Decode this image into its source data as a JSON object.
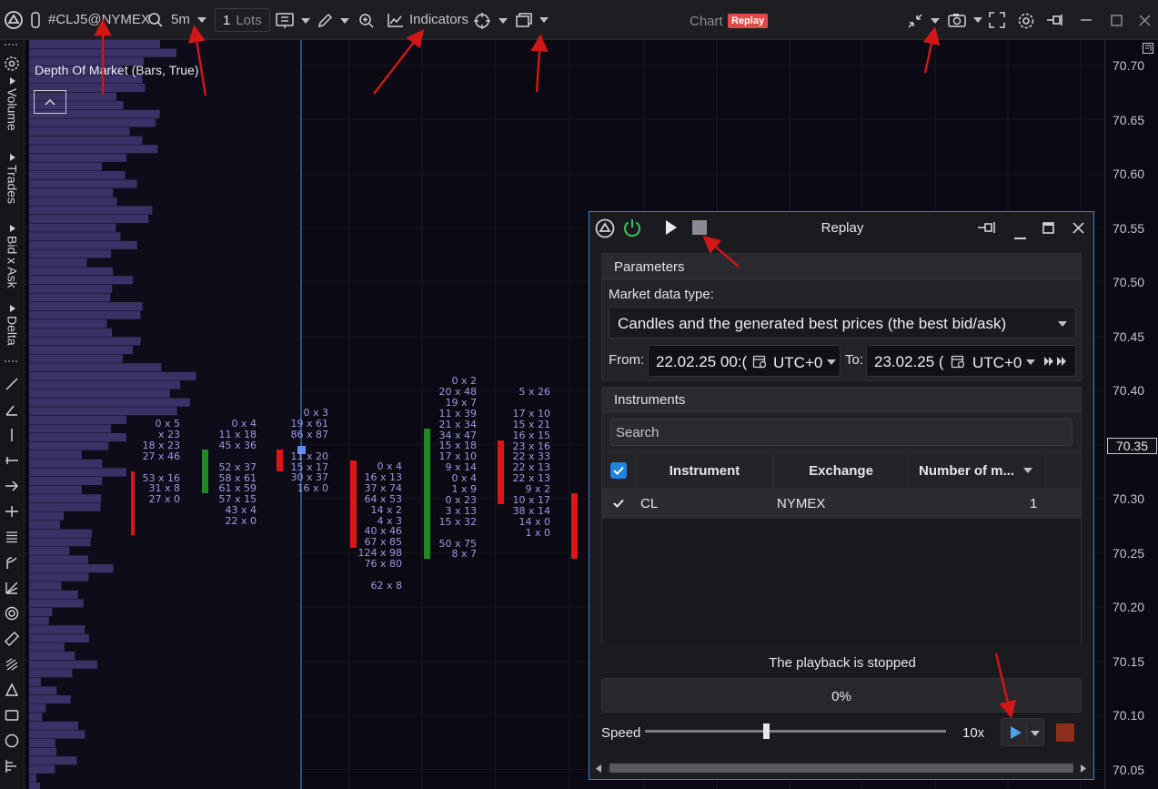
{
  "toolbar": {
    "symbol": "#CLJ5@NYMEX",
    "timeframe": "5m",
    "lots_value": "1",
    "lots_unit": "Lots",
    "indicators_label": "Indicators",
    "center_title": "Chart",
    "replay_badge": "Replay"
  },
  "left_panel": {
    "tabs": [
      "Volume",
      "Trades",
      "Bid x Ask",
      "Delta"
    ]
  },
  "chart": {
    "indicator_title": "Depth Of Market (Bars, True)",
    "price_ticks": [
      "70.70",
      "70.65",
      "70.60",
      "70.55",
      "70.50",
      "70.45",
      "70.40",
      "70.35",
      "70.30",
      "70.25",
      "70.20",
      "70.15",
      "70.10",
      "70.05"
    ],
    "current_price": "70.35",
    "footprint_columns": [
      [
        "0 x 5",
        "x 23",
        "18 x 23",
        "27 x 46",
        "",
        "53 x 16",
        "31 x 8",
        "27 x 0"
      ],
      [
        "0 x 4",
        "11 x 18",
        "45 x 36",
        "",
        "52 x 37",
        "58 x 61",
        "61 x 59",
        "57 x 15",
        "43 x 4",
        "22 x 0"
      ],
      [
        "0 x 3",
        "19 x 61",
        "86 x 87",
        "",
        "11 x 20",
        "15 x 17",
        "30 x 37",
        "16 x 0"
      ],
      [
        "0 x 4",
        "16 x 13",
        "37 x 74",
        "64 x 53",
        "14 x 2",
        "4 x 3",
        "40 x 46",
        "67 x 85",
        "124 x 98",
        "76 x 80",
        "",
        "62 x 8"
      ],
      [
        "0 x 2",
        "20 x 48",
        "19 x 7",
        "11 x 39",
        "21 x 34",
        "34 x 47",
        "15 x 18",
        "17 x 10",
        "9 x 14",
        "0 x 4",
        "1 x 9",
        "0 x 23",
        "3 x 13",
        "15 x 32",
        "",
        "50 x 75",
        "8 x 7"
      ],
      [
        "5 x 26",
        "",
        "17 x 10",
        "15 x 21",
        "16 x 15",
        "23 x 16",
        "22 x 33",
        "22 x 13",
        "22 x 13",
        "9 x 2",
        "10 x 17",
        "38 x 14",
        "14 x 0",
        "1 x 0"
      ]
    ]
  },
  "replay": {
    "title": "Replay",
    "parameters_header": "Parameters",
    "market_data_type_label": "Market data type:",
    "market_data_type_value": "Candles and the generated best prices (the best bid/ask)",
    "from_label": "From:",
    "from_value": "22.02.25 00:(",
    "from_tz": "UTC+0",
    "to_label": "To:",
    "to_value": "23.02.25 (",
    "to_tz": "UTC+0",
    "instruments_header": "Instruments",
    "search_placeholder": "Search",
    "columns": [
      "Instrument",
      "Exchange",
      "Number of m..."
    ],
    "rows": [
      {
        "instrument": "CL",
        "exchange": "NYMEX",
        "number": "1"
      }
    ],
    "status": "The playback is stopped",
    "progress": "0%",
    "progress_value": 0,
    "speed_label": "Speed",
    "speed_value": "10x"
  },
  "colors": {
    "background": "#0b0a12",
    "dom_bar": "#3b3167",
    "bull": "#1f8a22",
    "bear": "#e01414",
    "footprint_text": "#9d98e6",
    "accent_blue": "#3a82d2",
    "annotation_arrow": "#d11717",
    "badge": "#e24a4a"
  }
}
